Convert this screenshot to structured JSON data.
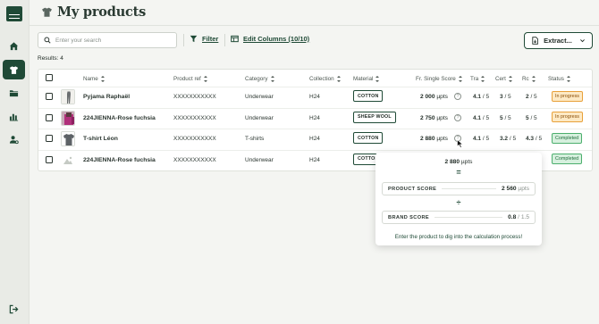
{
  "sidebar": {
    "items": [
      {
        "name": "home",
        "icon": "home-icon",
        "active": false
      },
      {
        "name": "products",
        "icon": "tshirt-icon",
        "active": true
      },
      {
        "name": "folders",
        "icon": "folder-icon",
        "active": false
      },
      {
        "name": "analytics",
        "icon": "bar-chart-icon",
        "active": false
      },
      {
        "name": "users",
        "icon": "user-settings-icon",
        "active": false
      }
    ],
    "logout_icon": "logout-icon"
  },
  "header": {
    "title": "My products"
  },
  "toolbar": {
    "search_placeholder": "Enter your search",
    "filter_label": "Filter",
    "edit_columns_label": "Edit Columns (10/10)",
    "extract_label": "Extract..."
  },
  "results_label": "Results: 4",
  "table": {
    "columns": [
      "Name",
      "Product ref",
      "Category",
      "Collection",
      "Material",
      "Fr. Single Score",
      "Tra",
      "Cert",
      "Rc",
      "Status"
    ],
    "rows": [
      {
        "name": "Pyjama Raphaël",
        "ref": "XXXXXXXXXXX",
        "category": "Underwear",
        "collection": "H24",
        "material": "COTTON",
        "score": "2 000",
        "unit": "µpts",
        "tra": "4.1",
        "tra_max": "/ 5",
        "cert": "3",
        "cert_max": "/ 5",
        "rc": "2",
        "rc_max": "/ 5",
        "status": "In progress",
        "thumb": "pyjama"
      },
      {
        "name": "224JIENNA-Rose fuchsia",
        "ref": "XXXXXXXXXXX",
        "category": "Underwear",
        "collection": "H24",
        "material": "SHEEP WOOL",
        "score": "2 750",
        "unit": "µpts",
        "tra": "4.1",
        "tra_max": "/ 5",
        "cert": "5",
        "cert_max": "/ 5",
        "rc": "5",
        "rc_max": "/ 5",
        "status": "In progress",
        "thumb": "fuchsia"
      },
      {
        "name": "T-shirt Léon",
        "ref": "XXXXXXXXXXX",
        "category": "T-shirts",
        "collection": "H24",
        "material": "COTTON",
        "score": "2 880",
        "unit": "µpts",
        "tra": "4.1",
        "tra_max": "/ 5",
        "cert": "3.2",
        "cert_max": "/ 5",
        "rc": "4.3",
        "rc_max": "/ 5",
        "status": "Completed",
        "thumb": "tshirt"
      },
      {
        "name": "224JIENNA-Rose fuchsia",
        "ref": "XXXXXXXXXXX",
        "category": "Underwear",
        "collection": "H24",
        "material": "COTTON",
        "score": "",
        "unit": "",
        "tra": "",
        "tra_max": "",
        "cert": "",
        "cert_max": "",
        "rc": "",
        "rc_max": "",
        "status": "Completed",
        "thumb": "placeholder"
      }
    ]
  },
  "popover": {
    "total_value": "2 880",
    "total_unit": "µpts",
    "equals": "=",
    "divide": "÷",
    "product_score_label": "PRODUCT SCORE",
    "product_score_value": "2 560",
    "product_score_unit": "µpts",
    "brand_score_label": "BRAND SCORE",
    "brand_score_value": "0.8",
    "brand_score_max": "/ 1.5",
    "link_text": "Enter the product to dig into the calculation process!"
  },
  "colors": {
    "brand": "#1f4a36",
    "in_progress_bg": "#fde9c4",
    "completed_bg": "#d6f0de"
  }
}
